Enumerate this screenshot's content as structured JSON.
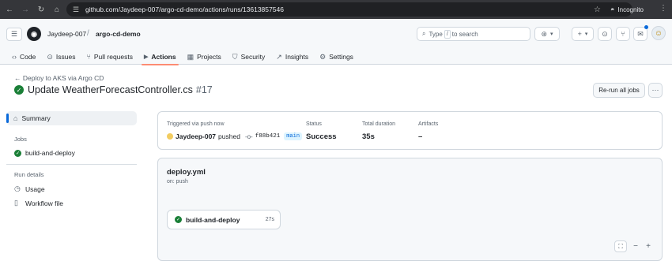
{
  "browser": {
    "url": "github.com/Jaydeep-007/argo-cd-demo/actions/runs/13613857546",
    "profile_label": "Incognito",
    "icons": [
      "back-arrow-icon",
      "forward-arrow-icon",
      "reload-icon",
      "home-icon",
      "site-info-icon",
      "bookmark-star-icon",
      "incognito-icon",
      "menu-icon"
    ]
  },
  "header": {
    "owner": "Jaydeep-007",
    "separator": "/",
    "repo": "argo-cd-demo",
    "search_prefix": "Type",
    "search_key": "/",
    "search_suffix": "to search"
  },
  "tabs": [
    {
      "label": "Code",
      "icon": "‹›"
    },
    {
      "label": "Issues",
      "icon": "⊙"
    },
    {
      "label": "Pull requests",
      "icon": "⑂"
    },
    {
      "label": "Actions",
      "icon": "▶",
      "active": true
    },
    {
      "label": "Projects",
      "icon": "▦"
    },
    {
      "label": "Security",
      "icon": "⛉"
    },
    {
      "label": "Insights",
      "icon": "↗"
    },
    {
      "label": "Settings",
      "icon": "⚙"
    }
  ],
  "run": {
    "back_label": "← Deploy to AKS via Argo CD",
    "title": "Update WeatherForecastController.cs",
    "number": "#17",
    "rerun_label": "Re-run all jobs"
  },
  "sidebar": {
    "summary_label": "Summary",
    "jobs_heading": "Jobs",
    "job_label": "build-and-deploy",
    "run_details_heading": "Run details",
    "usage_label": "Usage",
    "workflow_file_label": "Workflow file"
  },
  "summary": {
    "trigger_label": "Triggered via push now",
    "actor": "Jaydeep-007",
    "action": "pushed",
    "commit": "f88b421",
    "branch": "main",
    "status_label": "Status",
    "status_value": "Success",
    "duration_label": "Total duration",
    "duration_value": "35s",
    "artifacts_label": "Artifacts",
    "artifacts_value": "–"
  },
  "graph": {
    "workflow_file": "deploy.yml",
    "trigger": "on: push",
    "job_name": "build-and-deploy",
    "job_duration": "27s"
  },
  "colors": {
    "success": "#1a7f37",
    "accent": "#0969da",
    "active_tab_underline": "#fd8c73"
  }
}
